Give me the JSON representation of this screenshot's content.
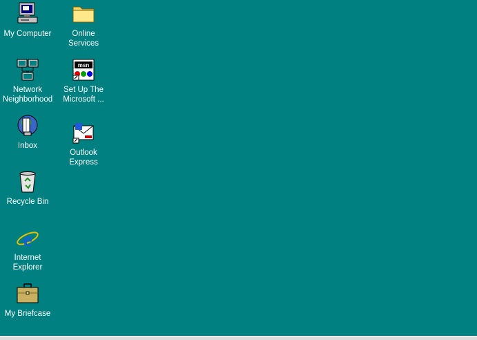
{
  "desktop": {
    "background_color": "#008080",
    "icons": [
      {
        "id": "my-computer",
        "label": "My Computer",
        "icon": "my-computer-icon"
      },
      {
        "id": "online-services",
        "label": "Online\nServices",
        "icon": "folder-icon"
      },
      {
        "id": "network-neighborhood",
        "label": "Network\nNeighborhood",
        "icon": "network-icon"
      },
      {
        "id": "msn-setup",
        "label": "Set Up The\nMicrosoft ...",
        "icon": "msn-icon"
      },
      {
        "id": "inbox",
        "label": "Inbox",
        "icon": "inbox-icon"
      },
      {
        "id": "outlook-express",
        "label": "Outlook\nExpress",
        "icon": "outlook-express-icon"
      },
      {
        "id": "recycle-bin",
        "label": "Recycle Bin",
        "icon": "recycle-bin-icon"
      },
      {
        "id": "internet-explorer",
        "label": "Internet\nExplorer",
        "icon": "internet-explorer-icon"
      },
      {
        "id": "my-briefcase",
        "label": "My Briefcase",
        "icon": "briefcase-icon"
      }
    ]
  }
}
